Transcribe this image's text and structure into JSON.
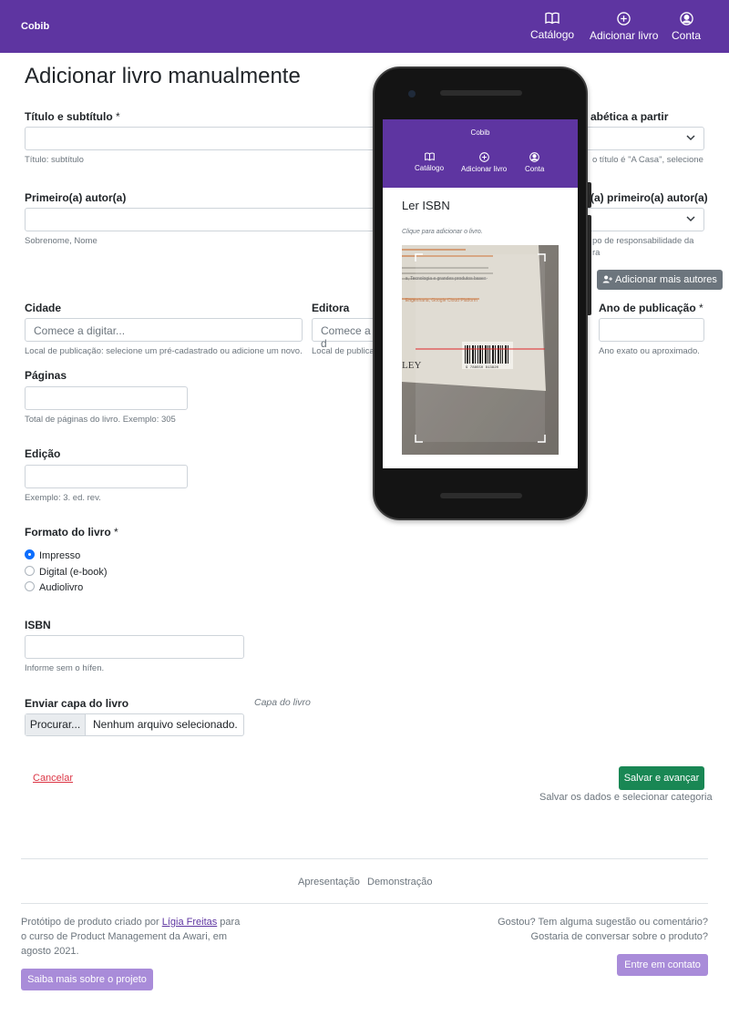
{
  "navbar": {
    "brand": "Cobib",
    "items": [
      {
        "label": "Catálogo",
        "icon": "book-icon"
      },
      {
        "label": "Adicionar livro",
        "icon": "plus-circle-icon"
      },
      {
        "label": "Conta",
        "icon": "person-circle-icon"
      }
    ]
  },
  "form": {
    "title": "Adicionar livro manualmente",
    "title_field": {
      "label": "Título e subtítulo",
      "required_mark": "*",
      "help": "Título: subtítulo"
    },
    "alpha_field": {
      "label_partial": "abética a partir",
      "help_partial": "o título é \"A Casa\", selecione"
    },
    "author_field": {
      "label": "Primeiro(a) autor(a)",
      "help": "Sobrenome, Nome"
    },
    "author_role_field": {
      "label_partial": "(a) primeiro(a) autor(a)",
      "help_partial_1": "po de responsabilidade da",
      "help_partial_2": "ra"
    },
    "add_authors_button": "Adicionar mais autores",
    "city_field": {
      "label": "Cidade",
      "placeholder": "Comece a digitar...",
      "help": "Local de publicação: selecione um pré-cadastrado ou adicione um novo."
    },
    "publisher_field": {
      "label": "Editora",
      "placeholder_partial": "Comece a d",
      "help_partial": "Local de publica"
    },
    "year_field": {
      "label": "Ano de publicação",
      "required_mark": "*",
      "help": "Ano exato ou aproximado."
    },
    "pages_field": {
      "label": "Páginas",
      "help": "Total de páginas do livro. Exemplo: 305"
    },
    "edition_field": {
      "label": "Edição",
      "help": "Exemplo: 3. ed. rev."
    },
    "format_field": {
      "label": "Formato do livro",
      "required_mark": "*",
      "options": [
        {
          "label": "Impresso",
          "checked": true
        },
        {
          "label": "Digital (e-book)",
          "checked": false
        },
        {
          "label": "Audiolivro",
          "checked": false
        }
      ]
    },
    "isbn_field": {
      "label": "ISBN",
      "help": "Informe sem o hífen."
    },
    "cover_field": {
      "label": "Enviar capa do livro",
      "browse": "Procurar...",
      "filename": "Nenhum arquivo selecionado.",
      "preview_caption": "Capa do livro"
    },
    "cancel": "Cancelar",
    "save_button": "Salvar e avançar",
    "save_help": "Salvar os dados e selecionar categoria"
  },
  "footer": {
    "links": [
      "Apresentação",
      "Demonstração"
    ],
    "left_text_before": "Protótipo de produto criado por ",
    "left_link": "Lígia Freitas",
    "left_text_after_line1": " para",
    "left_text_line2": "o curso de Product Management da Awari, em",
    "left_text_line3": "agosto 2021.",
    "learn_more_button": "Saiba mais sobre o projeto",
    "right_text_line1": "Gostou? Tem alguma sugestão ou comentário?",
    "right_text_line2": "Gostaria de conversar sobre o produto?",
    "contact_button": "Entre em contato"
  },
  "phone": {
    "brand": "Cobib",
    "nav": [
      "Catálogo",
      "Adicionar livro",
      "Conta"
    ],
    "title": "Ler ISBN",
    "hint": "Clique para adicionar o livro.",
    "scan_text_line1": "s, Tecnologia e grandes produtos basea-",
    "scan_text_line2": "Engenharia, Google Cloud Platform",
    "scan_publisher_partial": "LEY",
    "barcode_digits": "9 788550 813820"
  },
  "colors": {
    "brand_purple": "#5e35a1",
    "success_green": "#198754",
    "danger_red": "#dc3545",
    "secondary_grey": "#6c757d",
    "light_purple": "#a98cd9",
    "primary_blue": "#0d6efd"
  }
}
